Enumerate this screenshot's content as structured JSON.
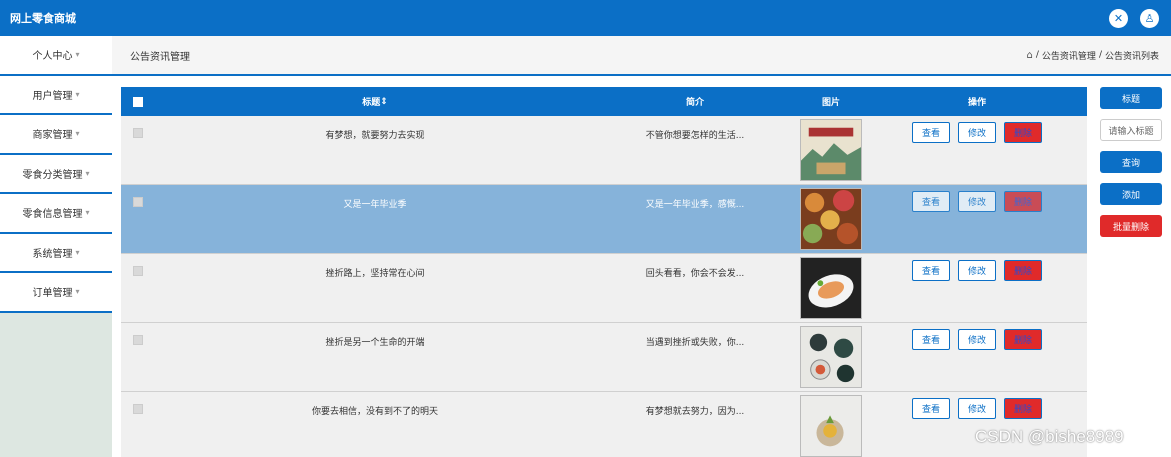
{
  "app": {
    "title": "网上零食商城"
  },
  "header_icons": [
    {
      "icon": "fullscreen-icon",
      "glyph": "✕"
    },
    {
      "icon": "user-icon",
      "glyph": "♙"
    }
  ],
  "sidebar": {
    "items": [
      {
        "label": "个人中心"
      },
      {
        "label": "用户管理"
      },
      {
        "label": "商家管理"
      },
      {
        "label": "零食分类管理"
      },
      {
        "label": "零食信息管理"
      },
      {
        "label": "系统管理"
      },
      {
        "label": "订单管理"
      }
    ],
    "caret": "▾"
  },
  "page": {
    "title": "公告资讯管理",
    "breadcrumb": [
      "公告资讯管理",
      "公告资讯列表"
    ],
    "breadcrumb_sep": "/"
  },
  "table": {
    "columns": {
      "title": "标题",
      "title_sort": "⇕",
      "intro": "简介",
      "image": "图片",
      "ops": "操作"
    },
    "actions": {
      "view": "查看",
      "edit": "修改",
      "delete": "删除"
    },
    "rows": [
      {
        "title": "有梦想，就要努力去实现",
        "intro": "不管你想要怎样的生活...",
        "selected": false
      },
      {
        "title": "又是一年毕业季",
        "intro": "又是一年毕业季，感慨...",
        "selected": true
      },
      {
        "title": "挫折路上，坚持常在心间",
        "intro": "回头看看，你会不会发...",
        "selected": false
      },
      {
        "title": "挫折是另一个生命的开端",
        "intro": "当遇到挫折或失败，你...",
        "selected": false
      },
      {
        "title": "你要去相信，没有到不了的明天",
        "intro": "有梦想就去努力，因为...",
        "selected": false
      }
    ]
  },
  "search_panel": {
    "field_label": "标题",
    "input_placeholder": "请输入标题",
    "query_button": "查询",
    "add_button": "添加",
    "batch_delete_button": "批量删除"
  },
  "watermark": "CSDN @bishe8989",
  "colors": {
    "primary": "#0b6fc6",
    "danger": "#e02a2a",
    "selected_row": "#86b3da"
  }
}
